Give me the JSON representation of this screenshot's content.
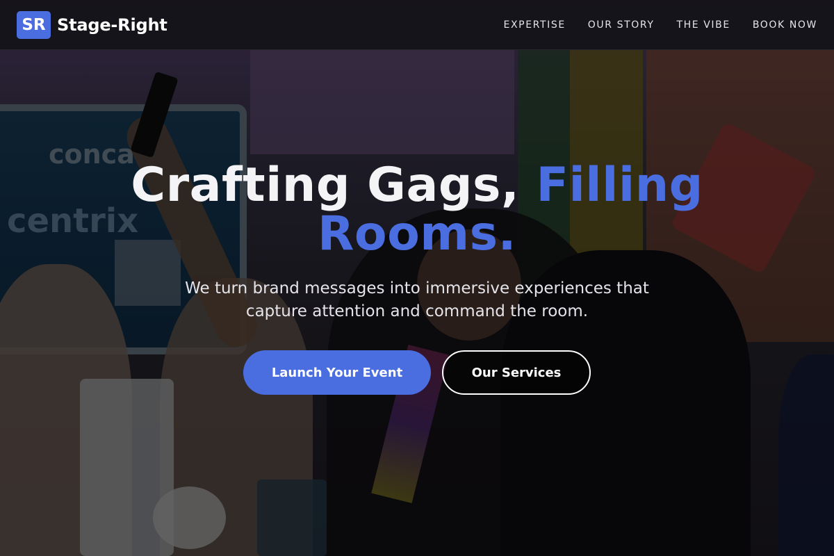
{
  "brand": {
    "logo_text": "SR",
    "name": "Stage-Right",
    "accent_color": "#4a6ee0"
  },
  "nav": {
    "links": [
      "EXPERTISE",
      "OUR STORY",
      "THE VIBE",
      "BOOK NOW"
    ]
  },
  "hero": {
    "title_plain": "Crafting Gags, ",
    "title_accent": "Filling Rooms.",
    "subtitle": "We turn brand messages into immersive experiences that capture attention and command the room.",
    "primary_button": "Launch Your Event",
    "secondary_button": "Our Services"
  }
}
